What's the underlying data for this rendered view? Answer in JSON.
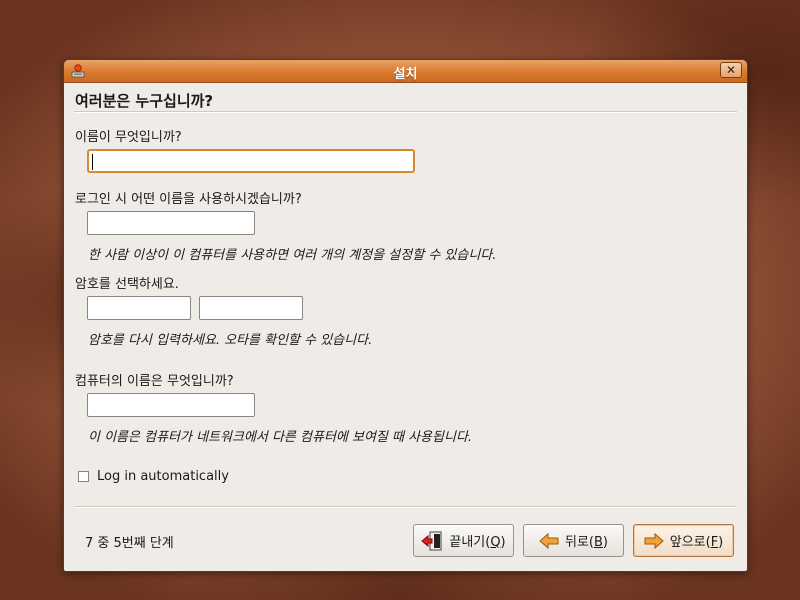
{
  "window": {
    "title": "설치"
  },
  "page": {
    "heading": "여러분은 누구십니까?"
  },
  "form": {
    "name_label": "이름이 무엇입니까?",
    "name_value": "",
    "login_label": "로그인 시 어떤 이름을 사용하시겠습니까?",
    "login_value": "",
    "login_hint": "한 사람 이상이 이 컴퓨터를 사용하면 여러 개의 계정을 설정할 수 있습니다.",
    "password_label": "암호를 선택하세요.",
    "password_value": "",
    "password_confirm_value": "",
    "password_hint": "암호를 다시 입력하세요. 오타를 확인할 수 있습니다.",
    "computer_label": "컴퓨터의 이름은 무엇입니까?",
    "computer_value": "",
    "computer_hint": "이 이름은 컴퓨터가 네트워크에서 다른 컴퓨터에 보여질 때 사용됩니다.",
    "autologin_label": "Log in automatically",
    "autologin_checked": false
  },
  "footer": {
    "step_text": "7 중 5번째 단계",
    "quit": {
      "text": "끝내기(",
      "mnemonic": "Q",
      "suffix": ")"
    },
    "back": {
      "text": "뒤로(",
      "mnemonic": "B",
      "suffix": ")"
    },
    "forward": {
      "text": "앞으로(",
      "mnemonic": "F",
      "suffix": ")"
    }
  },
  "colors": {
    "accent": "#d97a2e",
    "focus": "#d9882f"
  },
  "icons": [
    "installer-icon",
    "close-icon",
    "quit-icon",
    "back-arrow-icon",
    "forward-arrow-icon"
  ]
}
